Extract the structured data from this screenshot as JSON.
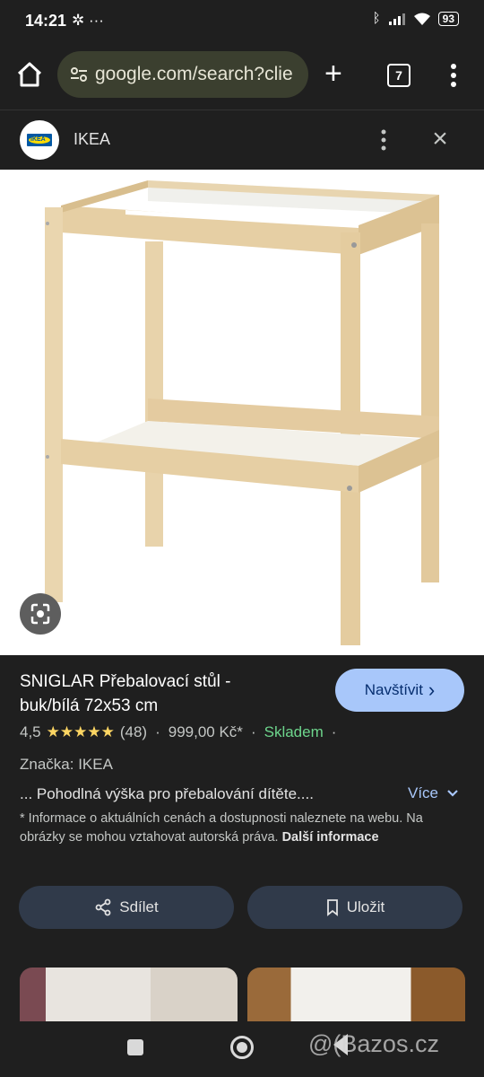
{
  "status": {
    "time": "14:21",
    "left_icons": "✲ ···",
    "battery": "93"
  },
  "browser": {
    "url": "google.com/search?clie",
    "tab_count": "7",
    "plus": "+",
    "menu": "⋮"
  },
  "sheet": {
    "brand": "IKEA",
    "logo_text": "IKEA",
    "close": "×"
  },
  "product": {
    "title": "SNIGLAR Přebalovací stůl - buk/bílá 72x53 cm",
    "visit_label": "Navštívit",
    "visit_chevron": "›",
    "rating": "4,5",
    "stars": "★★★★★",
    "reviews": "(48)",
    "price": "999,00 Kč*",
    "stock": "Skladem",
    "dot": "·",
    "brand_line": "Značka: IKEA",
    "description": "... Pohodlná výška pro přebalování dítěte....",
    "more_label": "Více",
    "more_chevron": "⌄",
    "disclaimer": "* Informace o aktuálních cenách a dostupnosti naleznete na webu. Na obrázky se mohou vztahovat autorská práva.",
    "disclaimer_link": "Další informace",
    "share_label": "Sdílet",
    "save_label": "Uložit"
  },
  "watermark": "@(Bazos.cz"
}
